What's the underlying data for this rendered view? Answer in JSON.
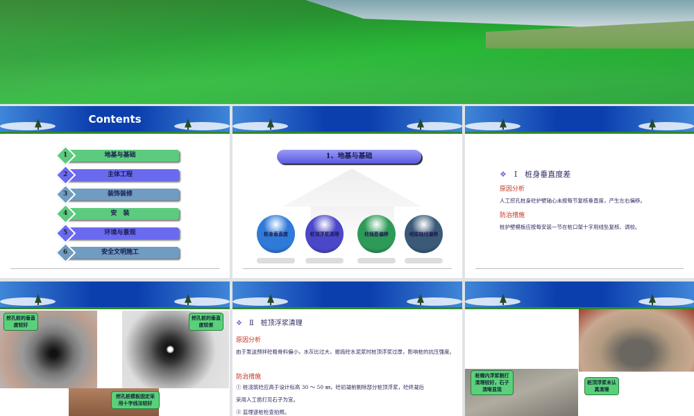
{
  "contents": {
    "title": "Contents",
    "items": [
      {
        "num": "1",
        "label": "地基与基础",
        "color": "#5ccb7e"
      },
      {
        "num": "2",
        "label": "主体工程",
        "color": "#6a6af0"
      },
      {
        "num": "3",
        "label": "装饰装修",
        "color": "#6f9cc0"
      },
      {
        "num": "4",
        "label": "安　装",
        "color": "#5ccb7e"
      },
      {
        "num": "5",
        "label": "环境与景观",
        "color": "#6a6af0"
      },
      {
        "num": "6",
        "label": "安全文明施工",
        "color": "#6f9cc0"
      }
    ]
  },
  "section": {
    "title": "1、地基与基础",
    "spheres": [
      {
        "label": "桩身垂直度",
        "color": "#2f7ad8"
      },
      {
        "label": "桩顶浮浆清理",
        "color": "#4a48c8"
      },
      {
        "label": "柱插筋偏移",
        "color": "#2e9a58"
      },
      {
        "label": "地梁轴线偏移",
        "color": "#3a5a78"
      }
    ]
  },
  "slide3": {
    "heading": "Ⅰ　桩身垂直度差",
    "cause_title": "原因分析",
    "cause": "人工挖孔桩身砼护壁轴心未按每节复核垂直度，产生左右偏移。",
    "measure_title": "防治措施",
    "measure": "桩护壁模板应按每安装一节在桩口架十字用线坠复核、调校。"
  },
  "slide4": {
    "bubbles": [
      "挖孔桩的垂直度较好",
      "挖孔桩的垂直度较差",
      "挖孔桩模板固定采用十字线法较好"
    ]
  },
  "slide5": {
    "heading": "Ⅱ　桩顶浮浆清理",
    "cause_title": "原因分析",
    "cause": "由于泵送预拌砼粗骨料偏小，水灰比过大，振捣砼水泥浆时桩顶浮浆过厚，影响桩的抗压强度。",
    "measure_title": "防治措施",
    "m1": "①  桩浇筑砼应高于设计标高 30 ～ 50 ㎜，砼初凝前剔除部分桩顶浮浆，砼终凝后",
    "m1b": "采用人工凿打见石子为宜。",
    "m2": "②  监理逐桩检查拍照。"
  },
  "slide6": {
    "bubbles": [
      "桩帽内浮浆剔打清理较好，石子清晰显现",
      "桩顶浮浆未认真清理"
    ]
  }
}
